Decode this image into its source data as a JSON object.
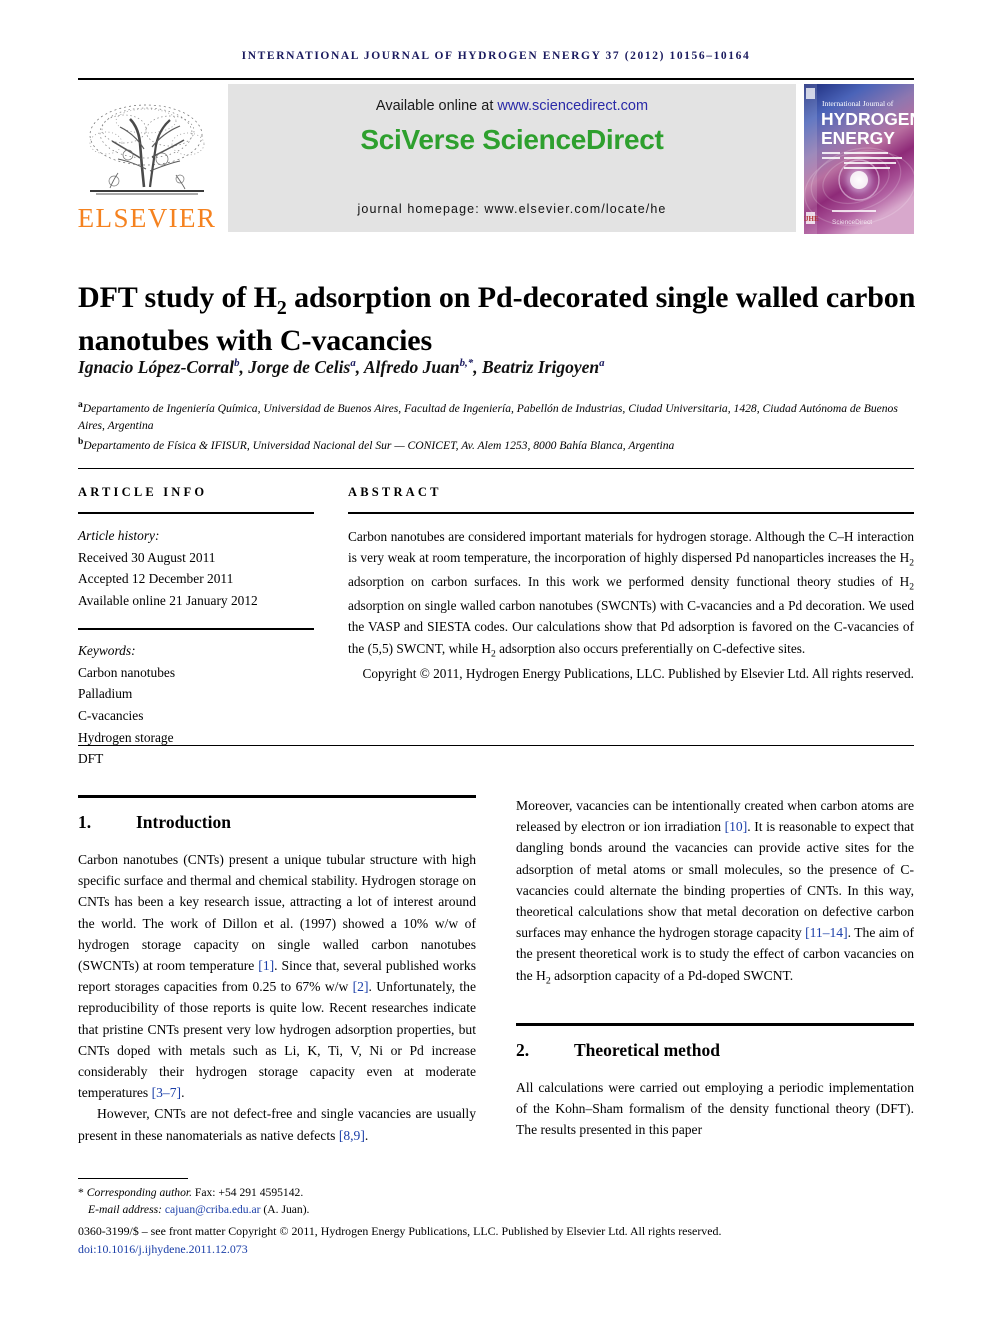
{
  "running_head": "International Journal of Hydrogen Energy 37 (2012) 10156–10164",
  "masthead": {
    "publisher_name": "ELSEVIER",
    "publisher_logo_name": "elsevier-tree-logo",
    "available_prefix": "Available online at ",
    "available_url": "www.sciencedirect.com",
    "sciencedirect_logo": "SciVerse ScienceDirect",
    "journal_homepage": "journal homepage: www.elsevier.com/locate/he",
    "cover": {
      "line1": "International Journal of",
      "line2": "HYDROGEN",
      "line3": "ENERGY",
      "editor_block": "Editor-in-Chief: T. Nejat Veziroglu  Associate Editors: S. Dunn, D.L. Block, M.A. Rosen, A.C. Marsden, J.W. Sheffield, S.A. Sherif and E.E. Shpilrain",
      "footer_mark": "ScienceDirect"
    }
  },
  "article": {
    "title_line1_pre": "DFT study of H",
    "title_line1_sub": "2",
    "title_line1_post": " adsorption on Pd-decorated single walled",
    "title_line2": "carbon nanotubes with C-vacancies",
    "authors": [
      {
        "name": "Ignacio López-Corral",
        "marks": "b"
      },
      {
        "name": "Jorge de Celis",
        "marks": "a"
      },
      {
        "name": "Alfredo Juan",
        "marks": "b,*"
      },
      {
        "name": "Beatriz Irigoyen",
        "marks": "a"
      }
    ],
    "affiliations": [
      {
        "mark": "a",
        "text": "Departamento de Ingeniería Química, Universidad de Buenos Aires, Facultad de Ingeniería, Pabellón de Industrias, Ciudad Universitaria, 1428, Ciudad Autónoma de Buenos Aires, Argentina"
      },
      {
        "mark": "b",
        "text": "Departamento de Física & IFISUR, Universidad Nacional del Sur — CONICET, Av. Alem 1253, 8000 Bahía Blanca, Argentina"
      }
    ]
  },
  "article_info": {
    "heading": "Article info",
    "history_label": "Article history:",
    "history": [
      "Received 30 August 2011",
      "Accepted 12 December 2011",
      "Available online 21 January 2012"
    ],
    "keywords_label": "Keywords:",
    "keywords": [
      "Carbon nanotubes",
      "Palladium",
      "C-vacancies",
      "Hydrogen storage",
      "DFT"
    ]
  },
  "abstract": {
    "heading": "Abstract",
    "part1": "Carbon nanotubes are considered important materials for hydrogen storage. Although the C–H interaction is very weak at room temperature, the incorporation of highly dispersed Pd nanoparticles increases the H",
    "sub1": "2",
    "part2": " adsorption on carbon surfaces. In this work we performed density functional theory studies of H",
    "sub2": "2",
    "part3": " adsorption on single walled carbon nanotubes (SWCNTs) with C-vacancies and a Pd decoration. We used the VASP and SIESTA codes. Our calculations show that Pd adsorption is favored on the C-vacancies of the (5,5) SWCNT, while H",
    "sub3": "2",
    "part4": " adsorption also occurs preferentially on C-defective sites.",
    "copyright": "Copyright © 2011, Hydrogen Energy Publications, LLC. Published by Elsevier Ltd. All rights reserved."
  },
  "sections": {
    "introduction": {
      "number": "1.",
      "title": "Introduction",
      "p1_a": "Carbon nanotubes (CNTs) present a unique tubular structure with high specific surface and thermal and chemical stability. Hydrogen storage on CNTs has been a key research issue, attracting a lot of interest around the world. The work of Dillon et al. (1997) showed a 10% w/w of hydrogen storage capacity on single walled carbon nanotubes (SWCNTs) at room temperature ",
      "p1_ref1": "[1]",
      "p1_b": ". Since that, several published works report storages capacities from 0.25 to 67% w/w ",
      "p1_ref2": "[2]",
      "p1_c": ". Unfortunately, the reproducibility of those reports is quite low. Recent researches indicate that pristine CNTs present very low hydrogen adsorption properties, but CNTs doped with metals such as Li, K, Ti, V, Ni or Pd increase considerably their hydrogen storage capacity even at moderate temperatures ",
      "p1_ref3": "[3–7]",
      "p1_d": ".",
      "p2_a": "However, CNTs are not defect-free and single vacancies are usually present in these nanomaterials as native defects ",
      "p2_ref1": "[8,9]",
      "p2_b": ".",
      "p3_a": "Moreover, vacancies can be intentionally created when carbon atoms are released by electron or ion irradiation ",
      "p3_ref1": "[10]",
      "p3_b": ". It is reasonable to expect that dangling bonds around the vacancies can provide active sites for the adsorption of metal atoms or small molecules, so the presence of C-vacancies could alternate the binding properties of CNTs. In this way, theoretical calculations show that metal decoration on defective carbon surfaces may enhance the hydrogen storage capacity ",
      "p3_ref2": "[11–14]",
      "p3_c": ". The aim of the present theoretical work is to study the effect of carbon vacancies on the H",
      "p3_sub": "2",
      "p3_d": " adsorption capacity of a Pd-doped SWCNT."
    },
    "theoretical_method": {
      "number": "2.",
      "title": "Theoretical method",
      "p1": "All calculations were carried out employing a periodic implementation of the Kohn–Sham formalism of the density functional theory (DFT). The results presented in this paper"
    }
  },
  "footer": {
    "corresponding_label": "Corresponding author.",
    "fax": " Fax: +54 291 4595142.",
    "email_label": "E-mail address: ",
    "email": "cajuan@criba.edu.ar",
    "email_suffix": " (A. Juan).",
    "imprint": "0360-3199/$ – see front matter Copyright © 2011, Hydrogen Energy Publications, LLC. Published by Elsevier Ltd. All rights reserved.",
    "doi": "doi:10.1016/j.ijhydene.2011.12.073"
  },
  "colors": {
    "running_head": "#1a1a5e",
    "elsevier_orange": "#F5821F",
    "sciencedirect_green": "#2ea02e",
    "link_blue": "#2a2aa8",
    "reference_blue": "#1a3ea8",
    "banner_gray": "#e3e3e3"
  }
}
